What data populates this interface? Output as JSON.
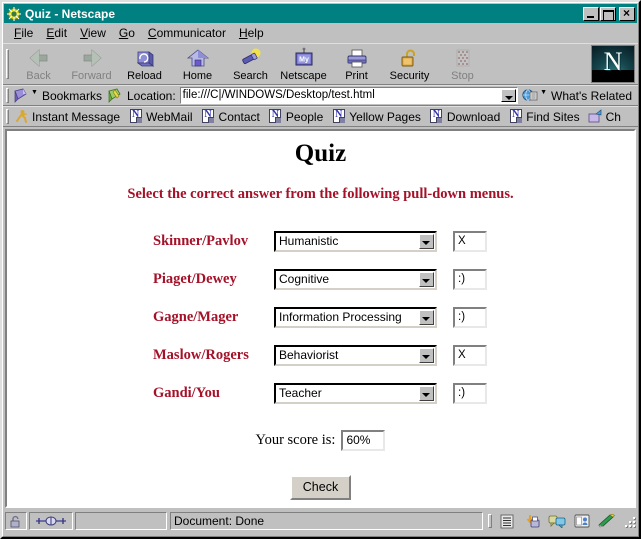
{
  "window": {
    "title": "Quiz - Netscape",
    "icon": "netscape-document-icon",
    "controls": {
      "minimize": "_",
      "maximize": "□",
      "close": "×"
    }
  },
  "menubar": {
    "items": [
      {
        "label": "File",
        "accel": "F"
      },
      {
        "label": "Edit",
        "accel": "E"
      },
      {
        "label": "View",
        "accel": "V"
      },
      {
        "label": "Go",
        "accel": "G"
      },
      {
        "label": "Communicator",
        "accel": "C"
      },
      {
        "label": "Help",
        "accel": "H"
      }
    ]
  },
  "toolbar": {
    "buttons": [
      {
        "label": "Back",
        "icon": "back-arrow-icon",
        "disabled": true
      },
      {
        "label": "Forward",
        "icon": "forward-arrow-icon",
        "disabled": true
      },
      {
        "label": "Reload",
        "icon": "reload-icon",
        "disabled": false
      },
      {
        "label": "Home",
        "icon": "home-icon",
        "disabled": false
      },
      {
        "label": "Search",
        "icon": "search-flashlight-icon",
        "disabled": false
      },
      {
        "label": "Netscape",
        "icon": "my-netscape-icon",
        "disabled": false
      },
      {
        "label": "Print",
        "icon": "printer-icon",
        "disabled": false
      },
      {
        "label": "Security",
        "icon": "padlock-icon",
        "disabled": false
      },
      {
        "label": "Stop",
        "icon": "stop-icon",
        "disabled": true
      }
    ],
    "logo_letter": "N"
  },
  "location_bar": {
    "bookmarks_label": "Bookmarks",
    "location_label": "Location:",
    "url": "file:///C|/WINDOWS/Desktop/test.html",
    "whats_related_label": "What's Related"
  },
  "personal_toolbar": {
    "items": [
      {
        "label": "Instant Message",
        "icon": "running-person-icon"
      },
      {
        "label": "WebMail",
        "icon": "page-icon"
      },
      {
        "label": "Contact",
        "icon": "page-icon"
      },
      {
        "label": "People",
        "icon": "page-icon"
      },
      {
        "label": "Yellow Pages",
        "icon": "page-icon"
      },
      {
        "label": "Download",
        "icon": "page-icon"
      },
      {
        "label": "Find Sites",
        "icon": "page-icon"
      },
      {
        "label": "Ch",
        "icon": "channels-icon"
      }
    ]
  },
  "page": {
    "title": "Quiz",
    "instruction": "Select the correct answer from the following pull-down menus.",
    "rows": [
      {
        "label": "Skinner/Pavlov",
        "selected": "Humanistic",
        "mark": "X"
      },
      {
        "label": "Piaget/Dewey",
        "selected": "Cognitive",
        "mark": ":)"
      },
      {
        "label": "Gagne/Mager",
        "selected": "Information Processing",
        "mark": ":)"
      },
      {
        "label": "Maslow/Rogers",
        "selected": "Behaviorist",
        "mark": "X"
      },
      {
        "label": "Gandi/You",
        "selected": "Teacher",
        "mark": ":)"
      }
    ],
    "score_label": "Your score is:",
    "score_value": "60%",
    "check_button": "Check",
    "colors": {
      "heading": "#000000",
      "label_red": "#a41128",
      "background": "#ffffff"
    }
  },
  "statusbar": {
    "text": "Document: Done",
    "lock_icon": "security-padlock-open-icon",
    "connection_icon": "network-connection-icon",
    "component_bar": [
      {
        "icon": "navigator-icon",
        "label": "Navigator"
      },
      {
        "icon": "mailbox-icon",
        "label": "Inbox"
      },
      {
        "icon": "newsgroups-icon",
        "label": "Newsgroups"
      },
      {
        "icon": "address-book-icon",
        "label": "Address Book"
      },
      {
        "icon": "composer-icon",
        "label": "Composer"
      }
    ]
  }
}
